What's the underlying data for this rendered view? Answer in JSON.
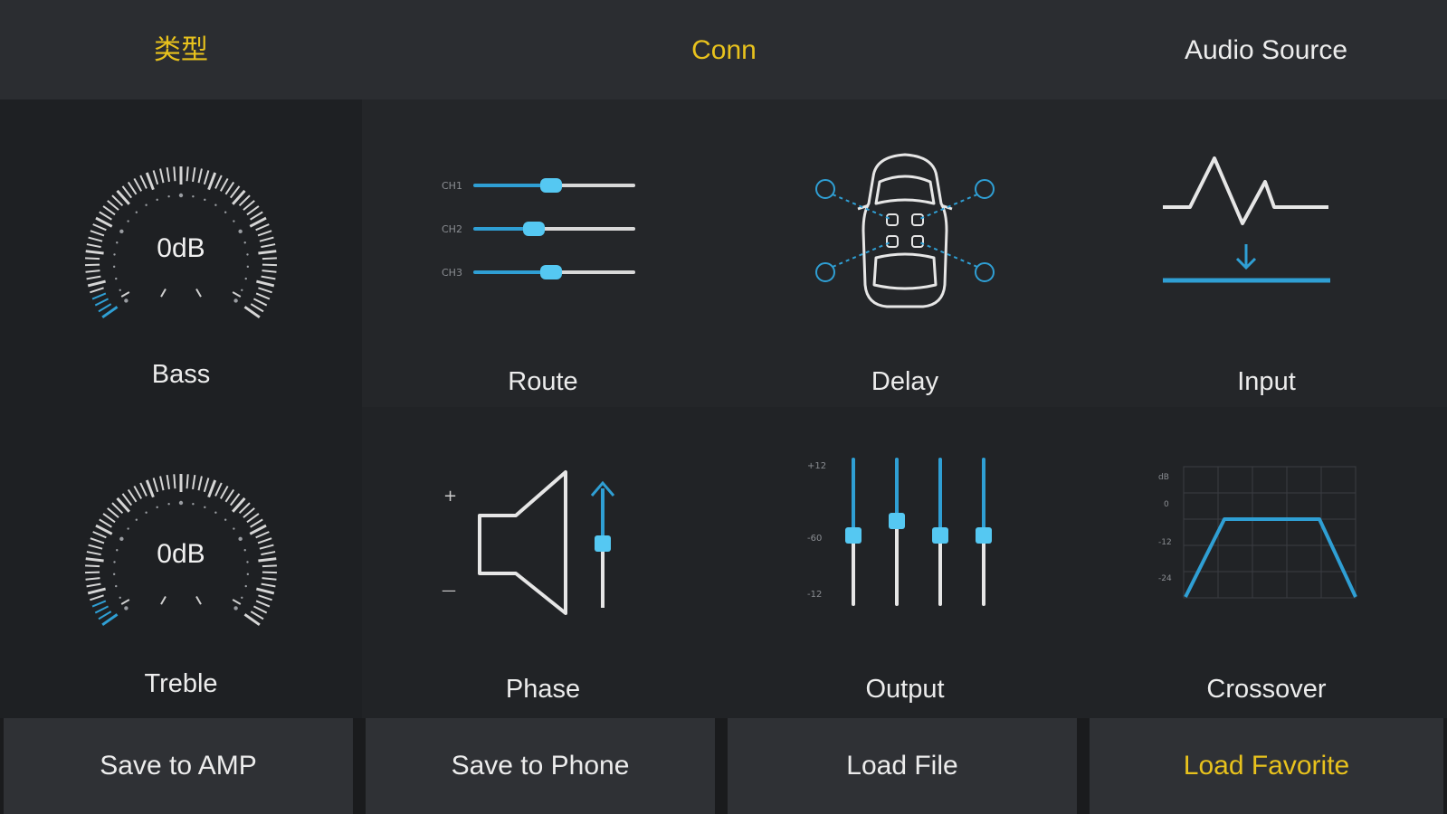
{
  "colors": {
    "accent_blue": "#2f9fd4",
    "accent_yellow": "#e8c21d",
    "bar_bg": "#2b2d31"
  },
  "topbar": {
    "items": [
      {
        "label": "类型",
        "color": "yellow"
      },
      {
        "label": "Conn",
        "color": "yellow"
      },
      {
        "label": "Audio Source",
        "color": "white"
      }
    ]
  },
  "tiles": {
    "bass": {
      "label": "Bass",
      "value": "0dB",
      "icon": "gauge-icon"
    },
    "route": {
      "label": "Route",
      "channels": [
        "CH1",
        "CH2",
        "CH3"
      ],
      "icon": "route-sliders-icon"
    },
    "delay": {
      "label": "Delay",
      "icon": "car-speakers-icon"
    },
    "input": {
      "label": "Input",
      "icon": "input-level-icon"
    },
    "treble": {
      "label": "Treble",
      "value": "0dB",
      "icon": "gauge-icon"
    },
    "phase": {
      "label": "Phase",
      "plus": "+",
      "minus": "—",
      "icon": "speaker-phase-icon"
    },
    "output": {
      "label": "Output",
      "scale_top": "+12",
      "scale_mid": "-60",
      "scale_bottom": "-12",
      "icon": "output-faders-icon"
    },
    "crossover": {
      "label": "Crossover",
      "scale": [
        "dB",
        "0",
        "-12",
        "-24"
      ],
      "icon": "crossover-curve-icon"
    }
  },
  "bottombar": {
    "buttons": [
      {
        "label": "Save to AMP",
        "color": "white"
      },
      {
        "label": "Save to Phone",
        "color": "white"
      },
      {
        "label": "Load File",
        "color": "white"
      },
      {
        "label": "Load Favorite",
        "color": "yellow"
      }
    ]
  }
}
